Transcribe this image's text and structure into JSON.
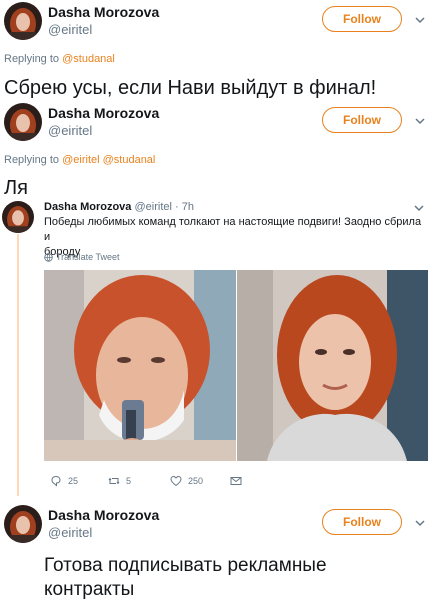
{
  "tweet1": {
    "name": "Dasha Morozova",
    "handle": "@eiritel",
    "follow_label": "Follow"
  },
  "reply1": {
    "prefix": "Replying to",
    "mention": "@studanal",
    "text": "Сбрею усы, если Нави выйдут в финал!"
  },
  "tweet2": {
    "name": "Dasha Morozova",
    "handle": "@eiritel",
    "follow_label": "Follow"
  },
  "reply2": {
    "prefix": "Replying to",
    "mentions": "@eiritel @studanal",
    "text": "Ля"
  },
  "quoted": {
    "name": "Dasha Morozova",
    "meta": "@eiritel · 7h",
    "text_line1": "Победы любимых команд толкают на настоящие подвиги! Заодно сбрила и",
    "text_line2": "бороду",
    "translate_label": "Translate Tweet",
    "actions": {
      "replies": "25",
      "retweets": "5",
      "likes": "250"
    }
  },
  "tweet3": {
    "name": "Dasha Morozova",
    "handle": "@eiritel",
    "follow_label": "Follow",
    "text_line1": "Готова подписывать рекламные",
    "text_line2": "контракты"
  },
  "colors": {
    "accent": "#e8821e",
    "text": "#14171a",
    "muted": "#657786",
    "thread": "#ffd9b3"
  },
  "icons": [
    "chevron-down-icon",
    "globe-icon",
    "reply-icon",
    "retweet-icon",
    "like-icon",
    "dm-icon"
  ]
}
